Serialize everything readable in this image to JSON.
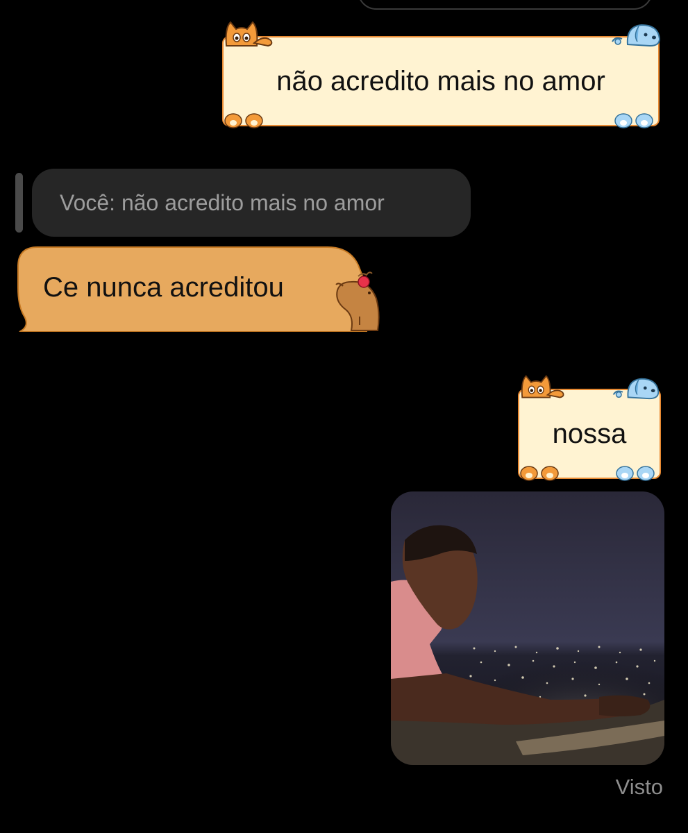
{
  "messages": {
    "sent_1": {
      "text": "não acredito mais no amor"
    },
    "reply_preview": {
      "text": "Você: não acredito mais no amor"
    },
    "received_1": {
      "text": "Ce nunca acreditou"
    },
    "sent_2": {
      "text": "nossa"
    },
    "sent_3": {
      "type": "image"
    }
  },
  "status": {
    "seen_label": "Visto"
  },
  "theme": {
    "sent_bubble_fill": "#fff3d2",
    "sent_bubble_border": "#e88a33",
    "received_bubble_fill": "#e7a95e",
    "reply_bubble_fill": "#262626",
    "background": "#000000"
  },
  "icons": [
    "cat-icon",
    "dog-icon",
    "paw-icon",
    "capybara-icon"
  ]
}
